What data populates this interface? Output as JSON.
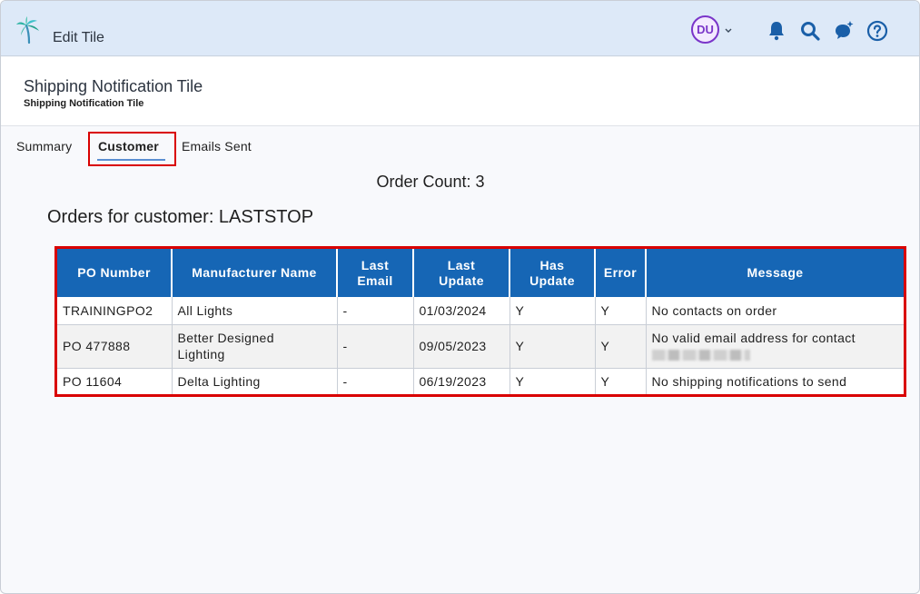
{
  "topbar": {
    "title": "Edit Tile",
    "avatar_initials": "DU",
    "icons": [
      "palm-tree-logo",
      "chevron-down-icon",
      "bell-icon",
      "search-icon",
      "chat-sparkle-icon",
      "help-icon"
    ]
  },
  "header": {
    "title": "Shipping Notification Tile",
    "subtitle": "Shipping Notification Tile"
  },
  "tabs": [
    {
      "label": "Summary",
      "active": false
    },
    {
      "label": "Customer",
      "active": true
    },
    {
      "label": "Emails Sent",
      "active": false
    }
  ],
  "main": {
    "order_count": "Order Count: 3",
    "orders_for": "Orders for customer: LASTSTOP"
  },
  "table": {
    "columns": [
      "PO Number",
      "Manufacturer Name",
      "Last Email",
      "Last Update",
      "Has Update",
      "Error",
      "Message"
    ],
    "rows": [
      {
        "po": "TRAININGPO2",
        "manufacturer": "All Lights",
        "last_email": "-",
        "last_update": "01/03/2024",
        "has_update": "Y",
        "error": "Y",
        "message": "No contacts on order"
      },
      {
        "po": "PO 477888",
        "manufacturer": "Better Designed Lighting",
        "last_email": "-",
        "last_update": "09/05/2023",
        "has_update": "Y",
        "error": "Y",
        "message": "No valid email address for contact"
      },
      {
        "po": "PO 11604",
        "manufacturer": "Delta Lighting",
        "last_email": "-",
        "last_update": "06/19/2023",
        "has_update": "Y",
        "error": "Y",
        "message": "No shipping notifications to send"
      }
    ]
  },
  "colors": {
    "topbar_bg": "#dde9f8",
    "table_header_bg": "#1666b5",
    "highlight_red": "#d90000",
    "avatar_purple": "#7a35c9",
    "icon_blue": "#1a5fa8"
  }
}
